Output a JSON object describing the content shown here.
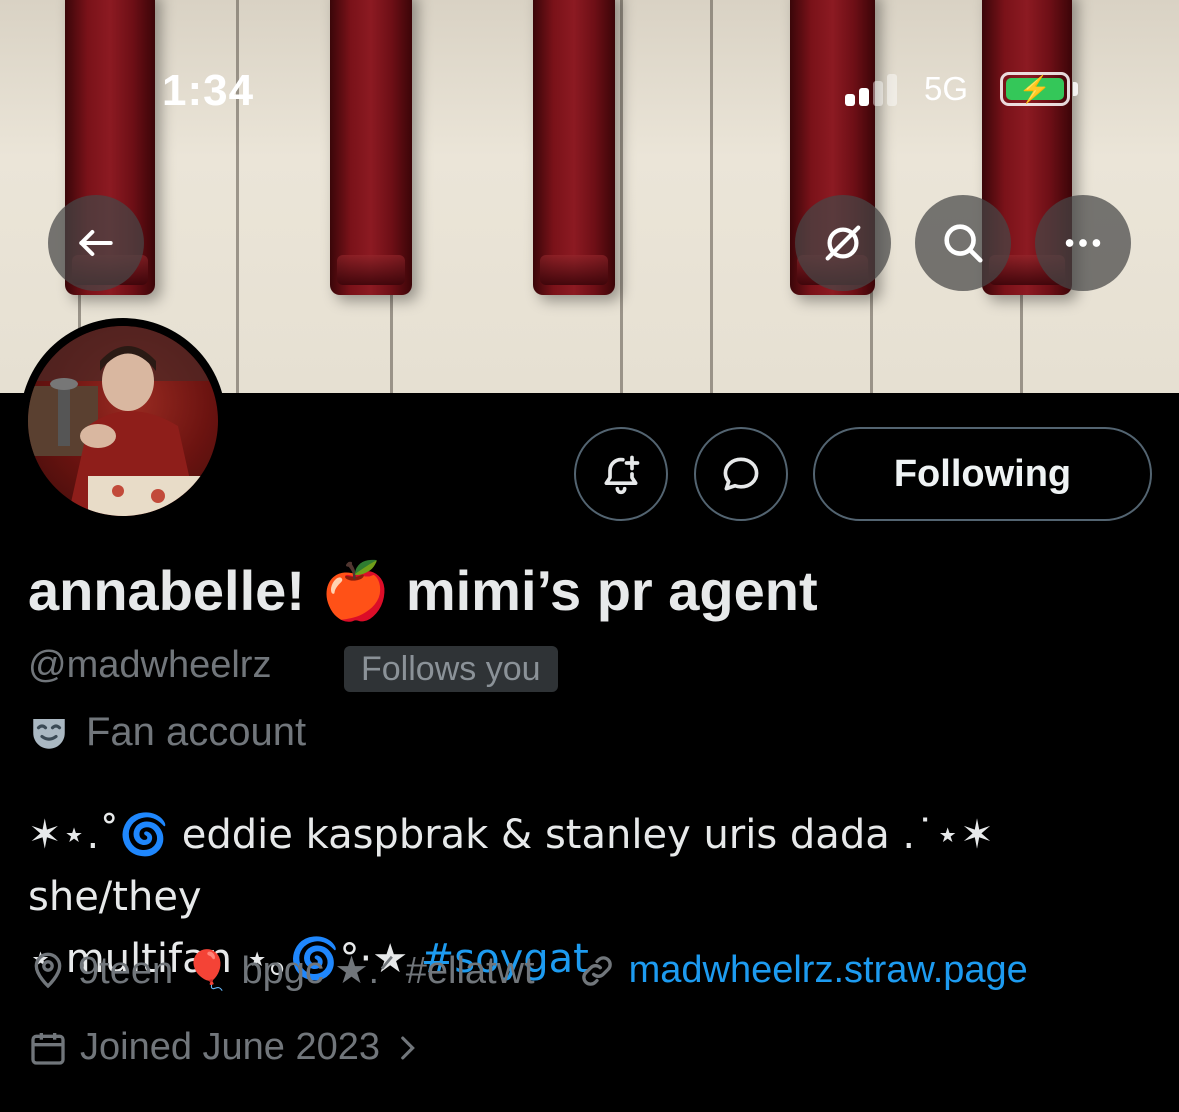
{
  "status_bar": {
    "time": "1:34",
    "network": "5G",
    "battery_charging": true,
    "battery_color": "#34c759"
  },
  "header": {
    "back_icon": "arrow-left-icon",
    "grok_icon": "slashed-circle-icon",
    "search_icon": "search-icon",
    "more_icon": "more-horizontal-icon"
  },
  "actions": {
    "notify_icon": "bell-plus-icon",
    "message_icon": "chat-bubble-icon",
    "following_label": "Following"
  },
  "profile": {
    "name_part1": "annabelle!",
    "name_emoji": "🍎",
    "name_part2": "mimi’s pr agent",
    "handle": "@madwheelrz",
    "follows_you": "Follows you",
    "category": "Fan account",
    "bio_line1": "✶⋆.˚🌀 eddie kaspbrak & stanley uris dada .⁠˙⋆✶ she/they",
    "bio_line2_text": "⋆ multifan ⋆｡🌀°·★ ",
    "bio_hashtag": "#soygat",
    "location": "9teen 🎈 bpgc ★.ᐟ #ellatwt",
    "website": "madwheelrz.straw.page",
    "joined": "Joined June 2023"
  },
  "colors": {
    "accent": "#1d9bf0",
    "secondary_text": "#71767b",
    "border": "#536471"
  }
}
